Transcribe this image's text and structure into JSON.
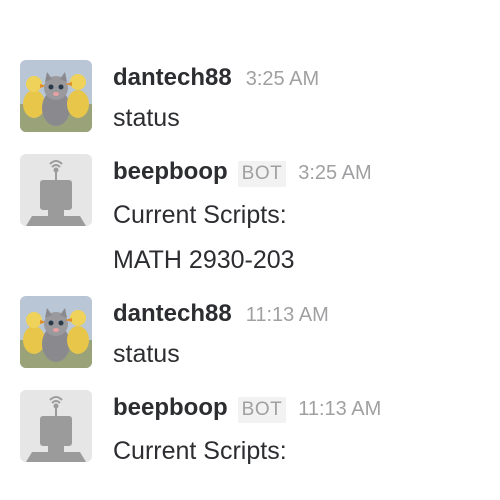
{
  "messages": [
    {
      "user": "dantech88",
      "bot": false,
      "bot_label": "",
      "time": "3:25 AM",
      "lines": [
        "status"
      ],
      "avatar": "kitten-ducklings-avatar"
    },
    {
      "user": "beepboop",
      "bot": true,
      "bot_label": "BOT",
      "time": "3:25 AM",
      "lines": [
        "Current Scripts:",
        "MATH 2930-203"
      ],
      "avatar": "robot-avatar"
    },
    {
      "user": "dantech88",
      "bot": false,
      "bot_label": "",
      "time": "11:13 AM",
      "lines": [
        "status"
      ],
      "avatar": "kitten-ducklings-avatar"
    },
    {
      "user": "beepboop",
      "bot": true,
      "bot_label": "BOT",
      "time": "11:13 AM",
      "lines": [
        "Current Scripts:"
      ],
      "avatar": "robot-avatar"
    }
  ],
  "colors": {
    "username": "#2c2d30",
    "timestamp": "#a0a0a2",
    "bot_badge_bg": "#f2f2f2",
    "robot_gray": "#9b9b9b"
  }
}
